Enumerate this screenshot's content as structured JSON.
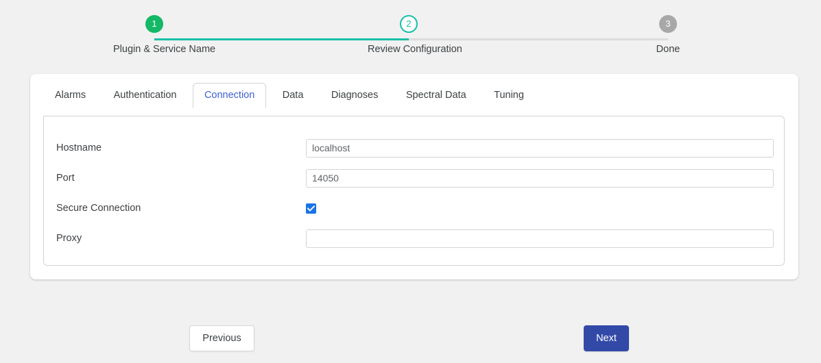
{
  "stepper": {
    "steps": [
      {
        "number": "1",
        "label": "Plugin & Service Name",
        "state": "done"
      },
      {
        "number": "2",
        "label": "Review Configuration",
        "state": "current"
      },
      {
        "number": "3",
        "label": "Done",
        "state": "todo"
      }
    ],
    "colors": {
      "done": "#14b866",
      "current": "#18bfa8",
      "todo": "#a8a8a8",
      "connector_active": "#18bfa8",
      "connector_inactive": "#dcdcdc"
    }
  },
  "tabs": [
    {
      "label": "Alarms",
      "active": false
    },
    {
      "label": "Authentication",
      "active": false
    },
    {
      "label": "Connection",
      "active": true
    },
    {
      "label": "Data",
      "active": false
    },
    {
      "label": "Diagnoses",
      "active": false
    },
    {
      "label": "Spectral Data",
      "active": false
    },
    {
      "label": "Tuning",
      "active": false
    }
  ],
  "tab_accent_color": "#3f5fd4",
  "form": {
    "hostname": {
      "label": "Hostname",
      "value": "localhost",
      "placeholder": ""
    },
    "port": {
      "label": "Port",
      "value": "14050",
      "placeholder": ""
    },
    "secure_connection": {
      "label": "Secure Connection",
      "checked": true,
      "color": "#1a73e8"
    },
    "proxy": {
      "label": "Proxy",
      "value": "",
      "placeholder": ""
    }
  },
  "footer": {
    "previous_label": "Previous",
    "next_label": "Next",
    "next_color": "#3349a8"
  }
}
